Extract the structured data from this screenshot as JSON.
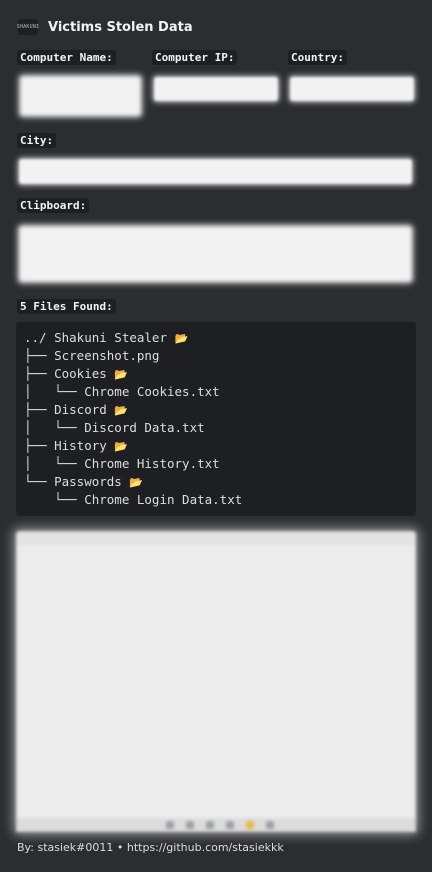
{
  "author": {
    "icon_text": "SHAKUNI",
    "name": "Victims Stolen Data"
  },
  "fields": {
    "computer_name_label": "Computer Name:",
    "computer_ip_label": "Computer IP:",
    "country_label": "Country:",
    "city_label": "City:",
    "clipboard_label": "Clipboard:"
  },
  "files": {
    "header": "5 Files Found:",
    "tree": [
      "../ Shakuni Stealer ",
      "├── Screenshot.png",
      "├── Cookies ",
      "│   └── Chrome Cookies.txt",
      "├── Discord ",
      "│   └── Discord Data.txt",
      "├── History ",
      "│   └── Chrome History.txt",
      "└── Passwords ",
      "    └── Chrome Login Data.txt"
    ],
    "folder_icon": "📂"
  },
  "footer": "By: stasiek#0011 • https://github.com/stasiekkk"
}
